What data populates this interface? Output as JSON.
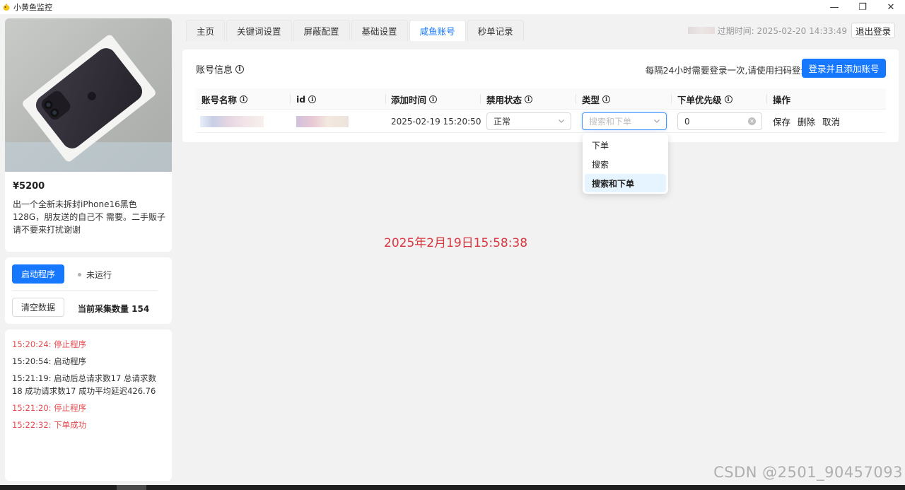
{
  "window": {
    "title": "小黄鱼监控",
    "controls": [
      "—",
      "❐",
      "✕"
    ]
  },
  "sidebar": {
    "product": {
      "price": "¥5200",
      "description": "出一个全新未拆封iPhone16黑色128G，朋友送的自己不 需要。二手贩子请不要来打扰谢谢"
    },
    "controls": {
      "start_label": "启动程序",
      "status_text": "未运行",
      "clear_label": "清空数据",
      "collect_count": "当前采集数量 154"
    },
    "logs": [
      {
        "text": "15:20:24: 停止程序",
        "color": "#e5484d"
      },
      {
        "text": "15:20:54: 启动程序",
        "color": "#333333"
      },
      {
        "text": "15:21:19: 启动后总请求数17 总请求数18 成功请求数17 成功平均延迟426.76",
        "color": "#333333"
      },
      {
        "text": "15:21:20: 停止程序",
        "color": "#e5484d"
      },
      {
        "text": "15:22:32: 下单成功",
        "color": "#e5484d"
      }
    ]
  },
  "tabs": [
    "主页",
    "关键词设置",
    "屏蔽配置",
    "基础设置",
    "咸鱼账号",
    "秒单记录"
  ],
  "active_tab": "咸鱼账号",
  "header": {
    "expire_text": "过期时间: 2025-02-20 14:33:49",
    "logout_label": "退出登录"
  },
  "account_panel": {
    "title": "账号信息",
    "login_hint": "每隔24小时需要登录一次,请使用扫码登录",
    "login_button": "登录并且添加账号",
    "columns": [
      "账号名称",
      "id",
      "添加时间",
      "禁用状态",
      "类型",
      "下单优先级",
      "操作"
    ],
    "row": {
      "added_time": "2025-02-19 15:20:50",
      "status_value": "正常",
      "type_placeholder": "搜索和下单",
      "priority_value": "0",
      "actions": [
        "保存",
        "删除",
        "取消"
      ]
    },
    "type_options": [
      "下单",
      "搜索",
      "搜索和下单"
    ],
    "type_selected": "搜索和下单"
  },
  "clock_text": "2025年2月19日15:58:38",
  "watermark": "CSDN @2501_90457093",
  "colors": {
    "primary": "#1677ff",
    "danger": "#e5484d",
    "clock": "#d9363e"
  }
}
